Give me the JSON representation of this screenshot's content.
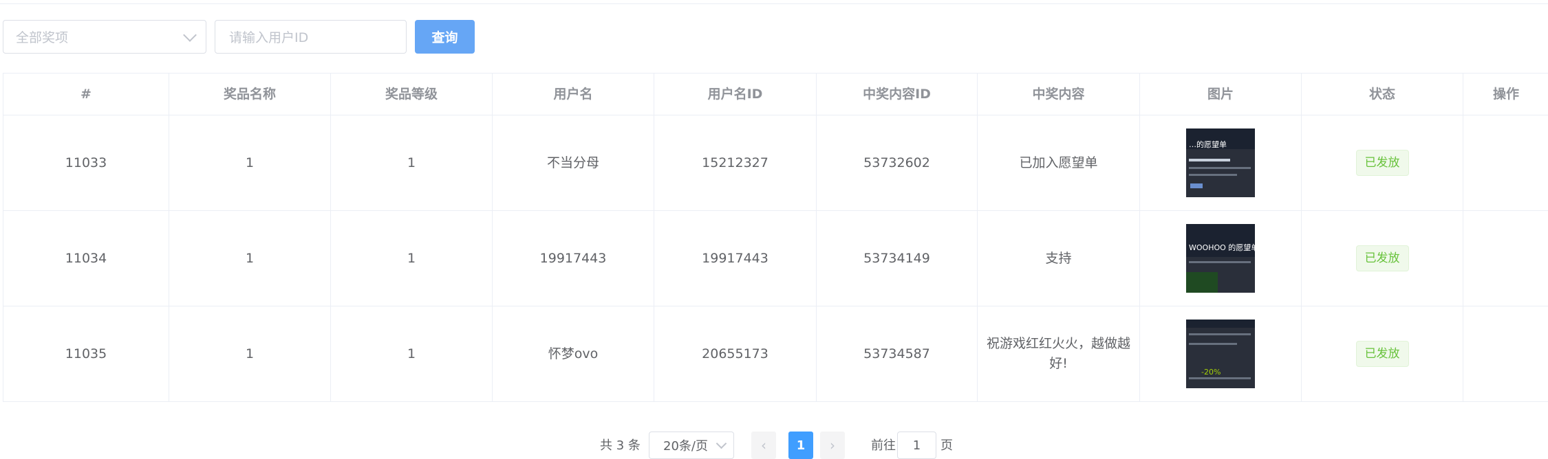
{
  "filters": {
    "prize_select_placeholder": "全部奖项",
    "user_id_placeholder": "请输入用户ID",
    "query_label": "查询"
  },
  "table": {
    "headers": [
      "#",
      "奖品名称",
      "奖品等级",
      "用户名",
      "用户名ID",
      "中奖内容ID",
      "中奖内容",
      "图片",
      "状态",
      "操作"
    ],
    "rows": [
      {
        "id": "11033",
        "prize_name": "1",
        "prize_level": "1",
        "username": "不当分母",
        "user_id": "15212327",
        "content_id": "53732602",
        "content": "已加入愿望单",
        "image_caption": "…的愿望单",
        "status": "已发放"
      },
      {
        "id": "11034",
        "prize_name": "1",
        "prize_level": "1",
        "username": "19917443",
        "user_id": "19917443",
        "content_id": "53734149",
        "content": "支持",
        "image_caption": "WOOHOO 的愿望单",
        "status": "已发放"
      },
      {
        "id": "11035",
        "prize_name": "1",
        "prize_level": "1",
        "username": "怀梦ovo",
        "user_id": "20655173",
        "content_id": "53734587",
        "content": "祝游戏红红火火，越做越好!",
        "image_caption": "-20%",
        "status": "已发放"
      }
    ]
  },
  "pagination": {
    "total": "共 3 条",
    "page_size": "20条/页",
    "prev": "‹",
    "current": "1",
    "next": "›",
    "goto_label": "前往",
    "goto_value": "1",
    "page_suffix": "页"
  }
}
